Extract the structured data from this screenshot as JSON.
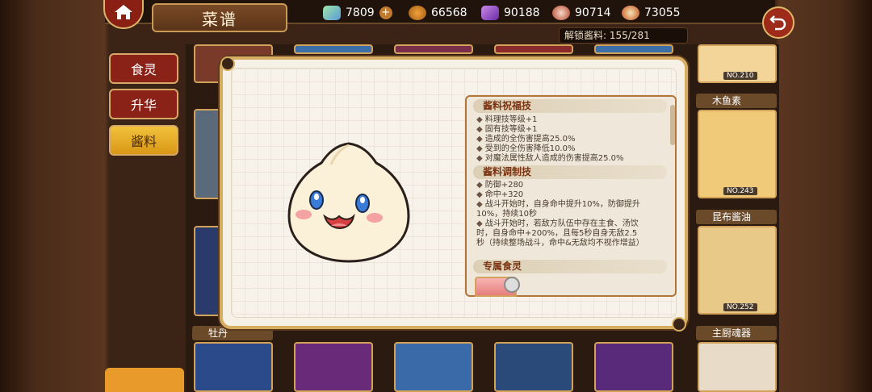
{
  "header": {
    "title": "菜谱",
    "unlock_label": "解锁酱料: 155/281"
  },
  "resources": [
    {
      "icon": "crystal-icon",
      "value": "7809",
      "has_plus": true
    },
    {
      "icon": "potion-icon",
      "value": "66568",
      "has_plus": false
    },
    {
      "icon": "purple-gem-icon",
      "value": "90188",
      "has_plus": false
    },
    {
      "icon": "meat-icon",
      "value": "90714",
      "has_plus": false
    },
    {
      "icon": "dish-icon",
      "value": "73055",
      "has_plus": false
    }
  ],
  "tabs": [
    {
      "label": "食灵",
      "active": false
    },
    {
      "label": "升华",
      "active": false
    },
    {
      "label": "酱料",
      "active": true
    }
  ],
  "cards": {
    "right_col": [
      {
        "name": "",
        "no": "NO.210"
      },
      {
        "name": "木鱼素",
        "no": "NO.243"
      },
      {
        "name": "昆布酱油",
        "no": "NO.252"
      },
      {
        "name": "主厨魂器",
        "no": ""
      }
    ],
    "bottom_row_label": "牡丹"
  },
  "sauce_detail": {
    "blessing": {
      "title": "酱料祝福技",
      "lines": [
        "料理技等级+1",
        "固有技等级+1",
        "造成的全伤害提高25.0%",
        "受到的全伤害降低10.0%",
        "对魔法属性敌人造成的伤害提高25.0%"
      ]
    },
    "craft": {
      "title": "酱料调制技",
      "lines": [
        "防御+280",
        "命中+320",
        "战斗开始时，自身命中提升10%，防御提升10%，持续10秒",
        "战斗开始时，若敌方队伍中存在主食、汤饮时，自身命中+200%，且每5秒自身无敌2.5秒（持续整场战斗，命中&无敌均不视作增益）"
      ]
    },
    "exclusive": {
      "title": "专属食灵"
    }
  },
  "colors": {
    "accent_red": "#8a2218",
    "active_tab": "#f1c23c",
    "panel_border": "#b2753a",
    "section_title": "#7a3412"
  }
}
